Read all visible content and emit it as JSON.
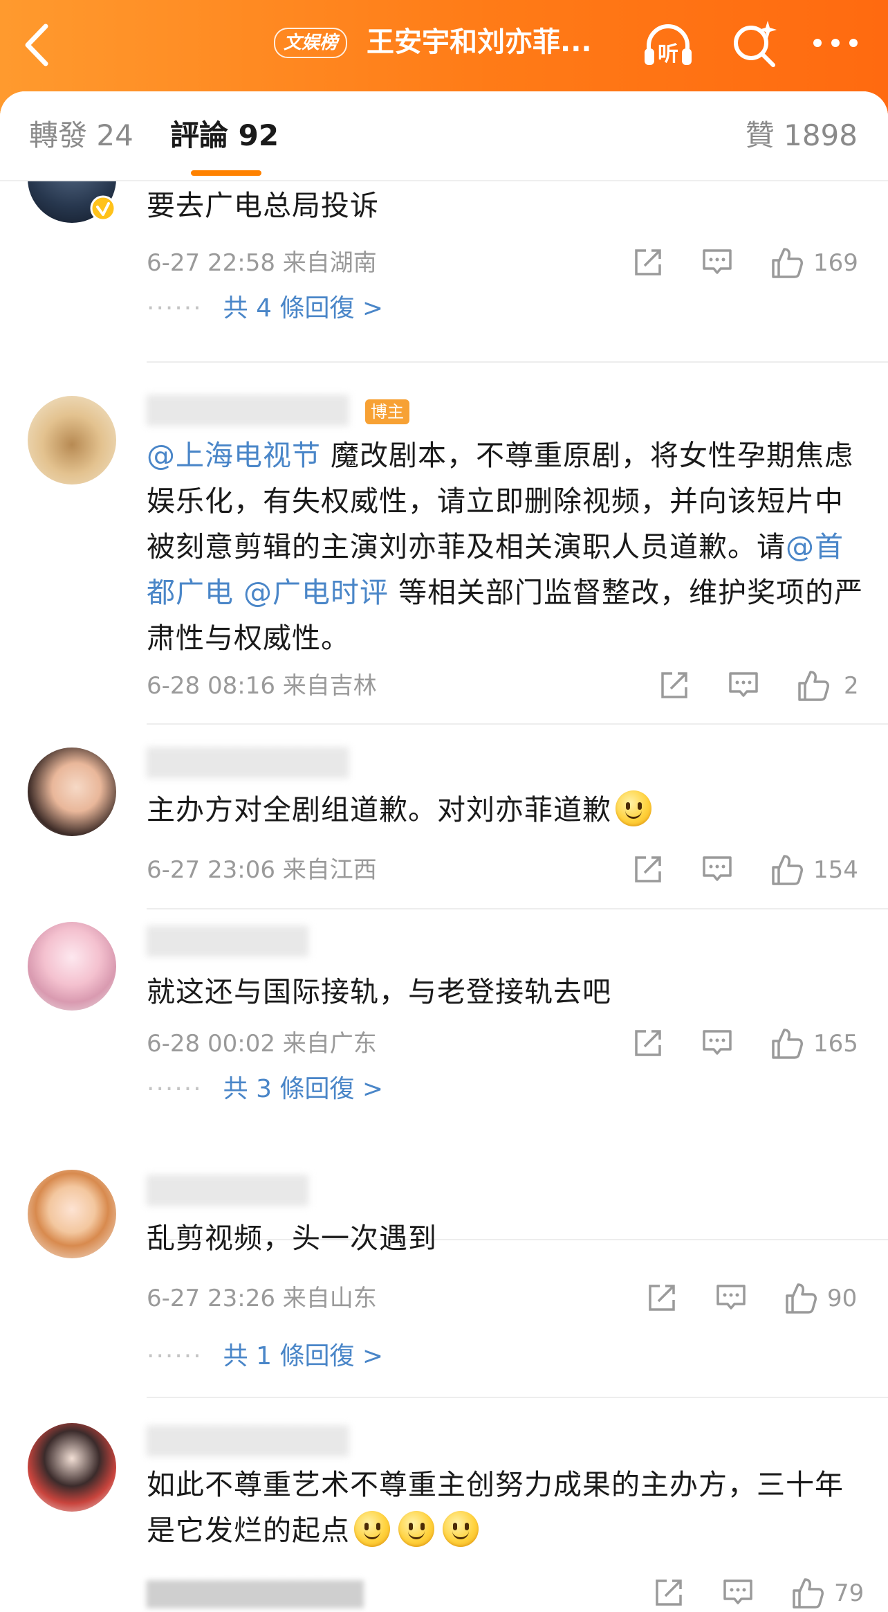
{
  "header": {
    "tag": "文娱榜",
    "title": "王安宇和刘亦菲...",
    "listen_label": "听",
    "back_icon": "back-chevron-icon",
    "search_icon": "search-sparkle-icon",
    "more_icon": "more-dots-icon",
    "gradient": [
      "#ff9a2e",
      "#ff6a10"
    ]
  },
  "tabs": {
    "repost": "轉發 24",
    "comment": "評論 92",
    "like": "贊 1898",
    "accent": "#ff8200"
  },
  "comments": [
    {
      "text": "要去广电总局投诉",
      "meta": "6-27 22:58  来自湖南",
      "likes": "169",
      "replies": "共 4 條回復 >",
      "verified": true
    },
    {
      "badge": "博主",
      "mention1": "@上海电视节",
      "text1": " 魔改剧本，不尊重原剧，将女性孕期焦虑娱乐化，有失权威性，请立即删除视频，并向该短片中被刻意剪辑的主演刘亦菲及相关演职人员道歉。请",
      "mention2": "@首都广电",
      "mention3": "@广电时评",
      "text2": " 等相关部门监督整改，维护奖项的严肃性与权威性。",
      "meta": "6-28 08:16  来自吉林",
      "likes": "2"
    },
    {
      "text": "主办方对全剧组道歉。对刘亦菲道歉",
      "meta": "6-27 23:06  来自江西",
      "likes": "154"
    },
    {
      "text": "就这还与国际接轨，与老登接轨去吧",
      "meta": "6-28 00:02  来自广东",
      "likes": "165",
      "replies": "共 3 條回復 >"
    },
    {
      "text": "乱剪视频，头一次遇到",
      "meta": "6-27 23:26  来自山东",
      "likes": "90",
      "replies": "共 1 條回復 >"
    },
    {
      "text": "如此不尊重艺术不尊重主创努力成果的主办方，三十年是它发烂的起点",
      "likes": "79"
    }
  ],
  "action_icons": [
    "share-icon",
    "comment-icon",
    "like-thumb-icon"
  ],
  "colors": {
    "link": "#4a86c8",
    "meta": "#9a9a9a"
  }
}
